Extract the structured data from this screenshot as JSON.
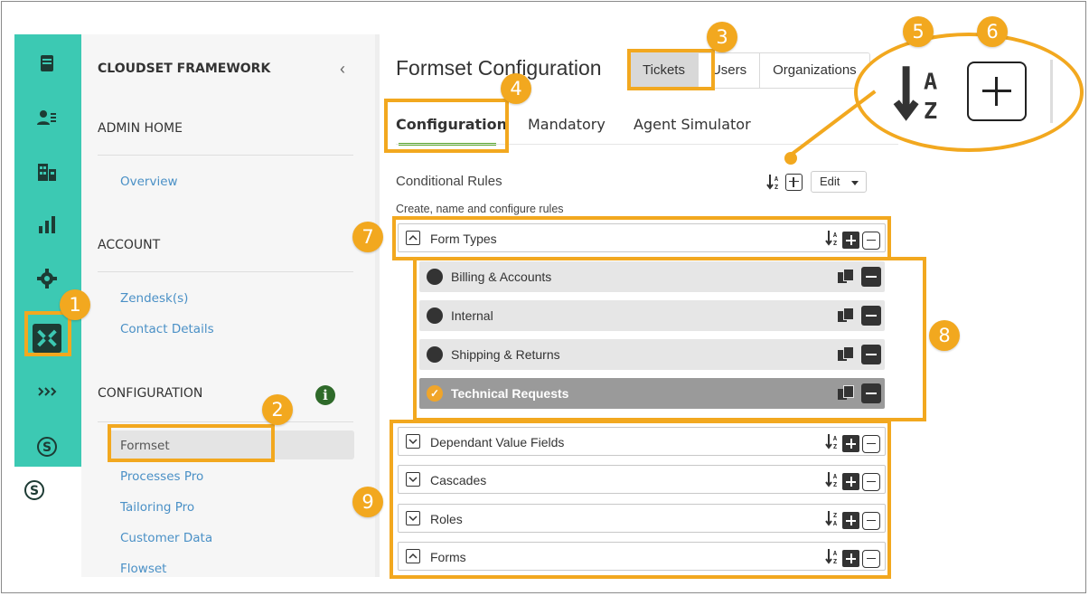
{
  "sidebar": {
    "title": "CLOUDSET FRAMEWORK",
    "collapse_glyph": "‹",
    "sections": [
      {
        "heading": "ADMIN HOME",
        "links": [
          "Overview"
        ]
      },
      {
        "heading": "ACCOUNT",
        "links": [
          "Zendesk(s)",
          "Contact Details"
        ]
      },
      {
        "heading": "CONFIGURATION",
        "links": [
          "Formset",
          "Processes Pro",
          "Tailoring Pro",
          "Customer Data",
          "Flowset"
        ]
      }
    ],
    "active_link": "Formset"
  },
  "rail_icons": [
    "server-icon",
    "contacts-icon",
    "building-icon",
    "bar-chart-icon",
    "gear-icon",
    "cloudset-logo-icon",
    "arrows-icon",
    "s-circle-icon",
    "s-circle-icon"
  ],
  "main": {
    "page_title": "Formset Configuration",
    "top_tabs": [
      "Tickets",
      "Users",
      "Organizations"
    ],
    "top_tab_selected": "Tickets",
    "sub_tabs": [
      "Configuration",
      "Mandatory",
      "Agent Simulator"
    ],
    "sub_tab_selected": "Configuration",
    "rules_title": "Conditional Rules",
    "rules_subtitle": "Create, name and configure rules",
    "edit_label": "Edit",
    "groups": {
      "form_types": "Form Types",
      "dependant": "Dependant Value Fields",
      "cascades": "Cascades",
      "roles": "Roles",
      "forms": "Forms"
    },
    "form_type_items": [
      "Billing & Accounts",
      "Internal",
      "Shipping & Returns",
      "Technical Requests"
    ],
    "selected_item": "Technical Requests"
  },
  "annotations": [
    "1",
    "2",
    "3",
    "4",
    "5",
    "6",
    "7",
    "8",
    "9"
  ],
  "colors": {
    "rail": "#3cc9b3",
    "annotation": "#f2a81f",
    "link": "#4a90c6",
    "underline": "#5ba92f"
  }
}
